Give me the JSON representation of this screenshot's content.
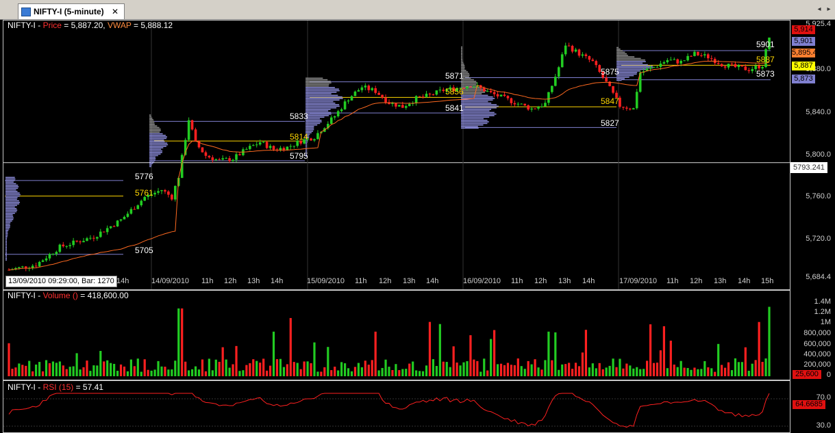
{
  "tab": {
    "title": "NIFTY-I (5-minute)",
    "close": "✕"
  },
  "nav": {
    "left": "◂",
    "right": "▸"
  },
  "price_title": {
    "symbol": "NIFTY-I - ",
    "price_label": "Price",
    "price_value": " = 5,887.20, ",
    "vwap_label": "VWAP",
    "vwap_value": " = 5,888.12"
  },
  "volume_title": {
    "symbol": "NIFTY-I - ",
    "label": "Volume  ()",
    "value": "  = 418,600.00"
  },
  "rsi_title": {
    "symbol": "NIFTY-I - ",
    "label": "RSI  (15)",
    "value": "  = 57.41"
  },
  "price_axis": {
    "ticks": [
      "5,925.4",
      "5,880.0",
      "5,840.0",
      "5,800.0",
      "5,760.0",
      "5,720.0",
      "5,684.4"
    ]
  },
  "price_tags": [
    {
      "text": "5,914",
      "bg": "#e01010",
      "fg": "#000000"
    },
    {
      "text": "5,901",
      "bg": "#8080d0",
      "fg": "#000000"
    },
    {
      "text": "5,895.4",
      "bg": "#ff8030",
      "fg": "#000000"
    },
    {
      "text": "5,887",
      "bg": "#ffff00",
      "fg": "#000000"
    },
    {
      "text": "5,873",
      "bg": "#8080d0",
      "fg": "#000000"
    }
  ],
  "crosshair_value": "5793.241",
  "date_box": "13/09/2010 09:29:00, Bar: 1270",
  "time_labels": [
    "14h",
    "14/09/2010",
    "11h",
    "12h",
    "13h",
    "14h",
    "15/09/2010",
    "11h",
    "12h",
    "13h",
    "14h",
    "16/09/2010",
    "11h",
    "12h",
    "13h",
    "14h",
    "17/09/2010",
    "11h",
    "12h",
    "13h",
    "14h",
    "15h"
  ],
  "level_labels": [
    "5776",
    "5761",
    "5705",
    "5833",
    "5814",
    "5795",
    "5871",
    "5856",
    "5841",
    "5875",
    "5847",
    "5827",
    "5901",
    "5887",
    "5873"
  ],
  "volume_axis": {
    "ticks": [
      "1.4M",
      "1.2M",
      "1M",
      "800,000",
      "600,000",
      "400,000",
      "200,000",
      "0"
    ],
    "tag": "25,600"
  },
  "rsi_axis": {
    "ticks": [
      "70.0",
      "30.0"
    ],
    "tag": "64.6685"
  },
  "colors": {
    "up": "#22cc22",
    "down": "#ff2020",
    "vwap": "#ff6a20",
    "profile": "#8a8ad8",
    "poc": "#ffd700",
    "grid": "#8080d0"
  },
  "chart_data": [
    {
      "type": "candlestick",
      "title": "NIFTY-I - Price = 5,887.20, VWAP = 5,888.12",
      "ylim": [
        5684.4,
        5925.4
      ],
      "y_ticks": [
        5684.4,
        5720,
        5760,
        5800,
        5840,
        5880,
        5925.4
      ],
      "x_tick_labels": [
        "14/09/2010",
        "15/09/2010",
        "16/09/2010",
        "17/09/2010"
      ],
      "last_price": 5887.2,
      "vwap": 5888.12,
      "session_levels": [
        {
          "session": "13/09/2010",
          "values": [
            5776,
            5761,
            5705
          ]
        },
        {
          "session": "14/09/2010",
          "values": [
            5833,
            5814,
            5795
          ]
        },
        {
          "session": "15/09/2010",
          "values": [
            5871,
            5856,
            5841
          ]
        },
        {
          "session": "16/09/2010",
          "values": [
            5875,
            5847,
            5827
          ]
        },
        {
          "session": "17/09/2010",
          "values": [
            5901,
            5887,
            5873
          ]
        }
      ],
      "price_path": [
        [
          0,
          5690
        ],
        [
          8,
          5695
        ],
        [
          15,
          5712
        ],
        [
          25,
          5722
        ],
        [
          33,
          5738
        ],
        [
          40,
          5760
        ],
        [
          45,
          5767
        ],
        [
          48,
          5760
        ],
        [
          50,
          5780
        ],
        [
          53,
          5835
        ],
        [
          55,
          5812
        ],
        [
          58,
          5800
        ],
        [
          62,
          5795
        ],
        [
          66,
          5797
        ],
        [
          70,
          5806
        ],
        [
          74,
          5813
        ],
        [
          78,
          5806
        ],
        [
          82,
          5808
        ],
        [
          86,
          5814
        ],
        [
          90,
          5818
        ],
        [
          92,
          5825
        ],
        [
          96,
          5838
        ],
        [
          100,
          5855
        ],
        [
          104,
          5866
        ],
        [
          108,
          5862
        ],
        [
          112,
          5851
        ],
        [
          116,
          5847
        ],
        [
          120,
          5855
        ],
        [
          124,
          5858
        ],
        [
          128,
          5863
        ],
        [
          132,
          5865
        ],
        [
          136,
          5868
        ],
        [
          138,
          5866
        ],
        [
          142,
          5860
        ],
        [
          146,
          5855
        ],
        [
          150,
          5850
        ],
        [
          154,
          5845
        ],
        [
          158,
          5850
        ],
        [
          162,
          5885
        ],
        [
          164,
          5907
        ],
        [
          168,
          5898
        ],
        [
          172,
          5890
        ],
        [
          176,
          5870
        ],
        [
          180,
          5848
        ],
        [
          184,
          5845
        ],
        [
          186,
          5880
        ],
        [
          190,
          5885
        ],
        [
          194,
          5892
        ],
        [
          198,
          5890
        ],
        [
          202,
          5898
        ],
        [
          206,
          5895
        ],
        [
          210,
          5888
        ],
        [
          214,
          5885
        ],
        [
          218,
          5883
        ],
        [
          222,
          5887
        ],
        [
          224,
          5914
        ]
      ]
    },
    {
      "type": "bar",
      "title": "NIFTY-I - Volume () = 418,600.00",
      "ylim": [
        0,
        1400000
      ],
      "y_ticks": [
        0,
        200000,
        400000,
        600000,
        800000,
        1000000,
        1200000,
        1400000
      ],
      "last_value": 418600
    },
    {
      "type": "line",
      "title": "NIFTY-I - RSI (15) = 57.41",
      "ylim": [
        30,
        70
      ],
      "y_ticks": [
        30,
        70
      ],
      "last_value": 64.6685
    }
  ]
}
